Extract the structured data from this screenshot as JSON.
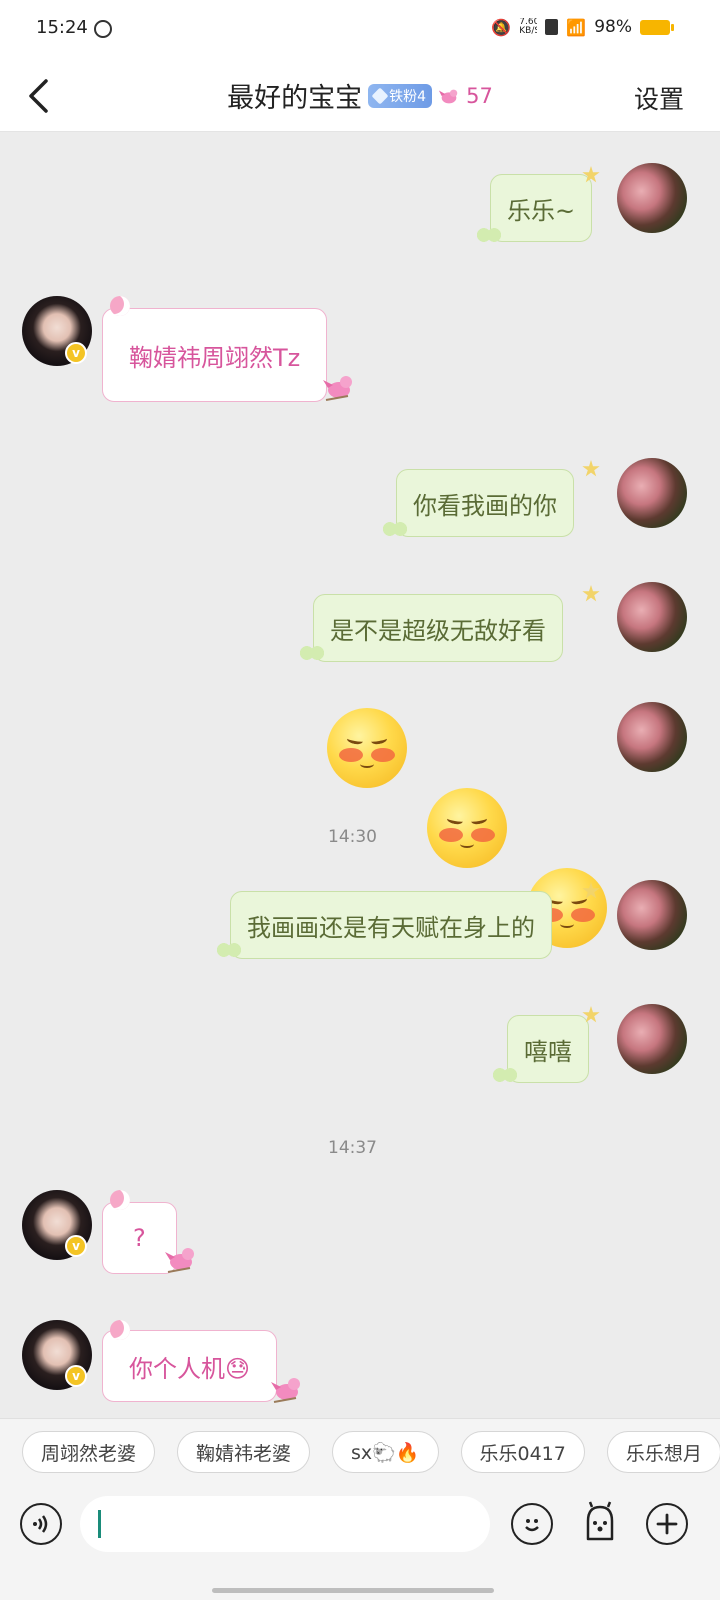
{
  "status_bar": {
    "time": "15:24",
    "network_speed": "7.60 KB/S",
    "battery": "98%",
    "battery_color": "#f7b500"
  },
  "header": {
    "title": "最好的宝宝",
    "fan_badge": "铁粉4",
    "fan_count": "57",
    "settings_label": "设置",
    "fan_color": "#d7559c"
  },
  "messages": [
    {
      "side": "me",
      "text": "乐乐~"
    },
    {
      "side": "her",
      "text": "鞠婧祎周翊然Tz"
    },
    {
      "side": "me",
      "text": "你看我画的你"
    },
    {
      "side": "me",
      "text": "是不是超级无敌好看"
    },
    {
      "side": "me",
      "type": "emoji",
      "count": 3,
      "emoji": "shy-blush-face"
    },
    {
      "type": "time",
      "text": "14:30"
    },
    {
      "side": "me",
      "text": "我画画还是有天赋在身上的"
    },
    {
      "side": "me",
      "text": "嘻嘻"
    },
    {
      "type": "time",
      "text": "14:37"
    },
    {
      "side": "her",
      "text": "?"
    },
    {
      "side": "her",
      "text": "你个人机😓"
    }
  ],
  "quick_replies": [
    "周翊然老婆",
    "鞠婧祎老婆",
    "sx🐑🔥",
    "乐乐0417",
    "乐乐想月"
  ],
  "input": {
    "placeholder": ""
  },
  "colors": {
    "my_bubble_bg": "#eaf6da",
    "my_text": "#5a6b35",
    "her_text": "#d7559c",
    "background": "#ececec"
  }
}
